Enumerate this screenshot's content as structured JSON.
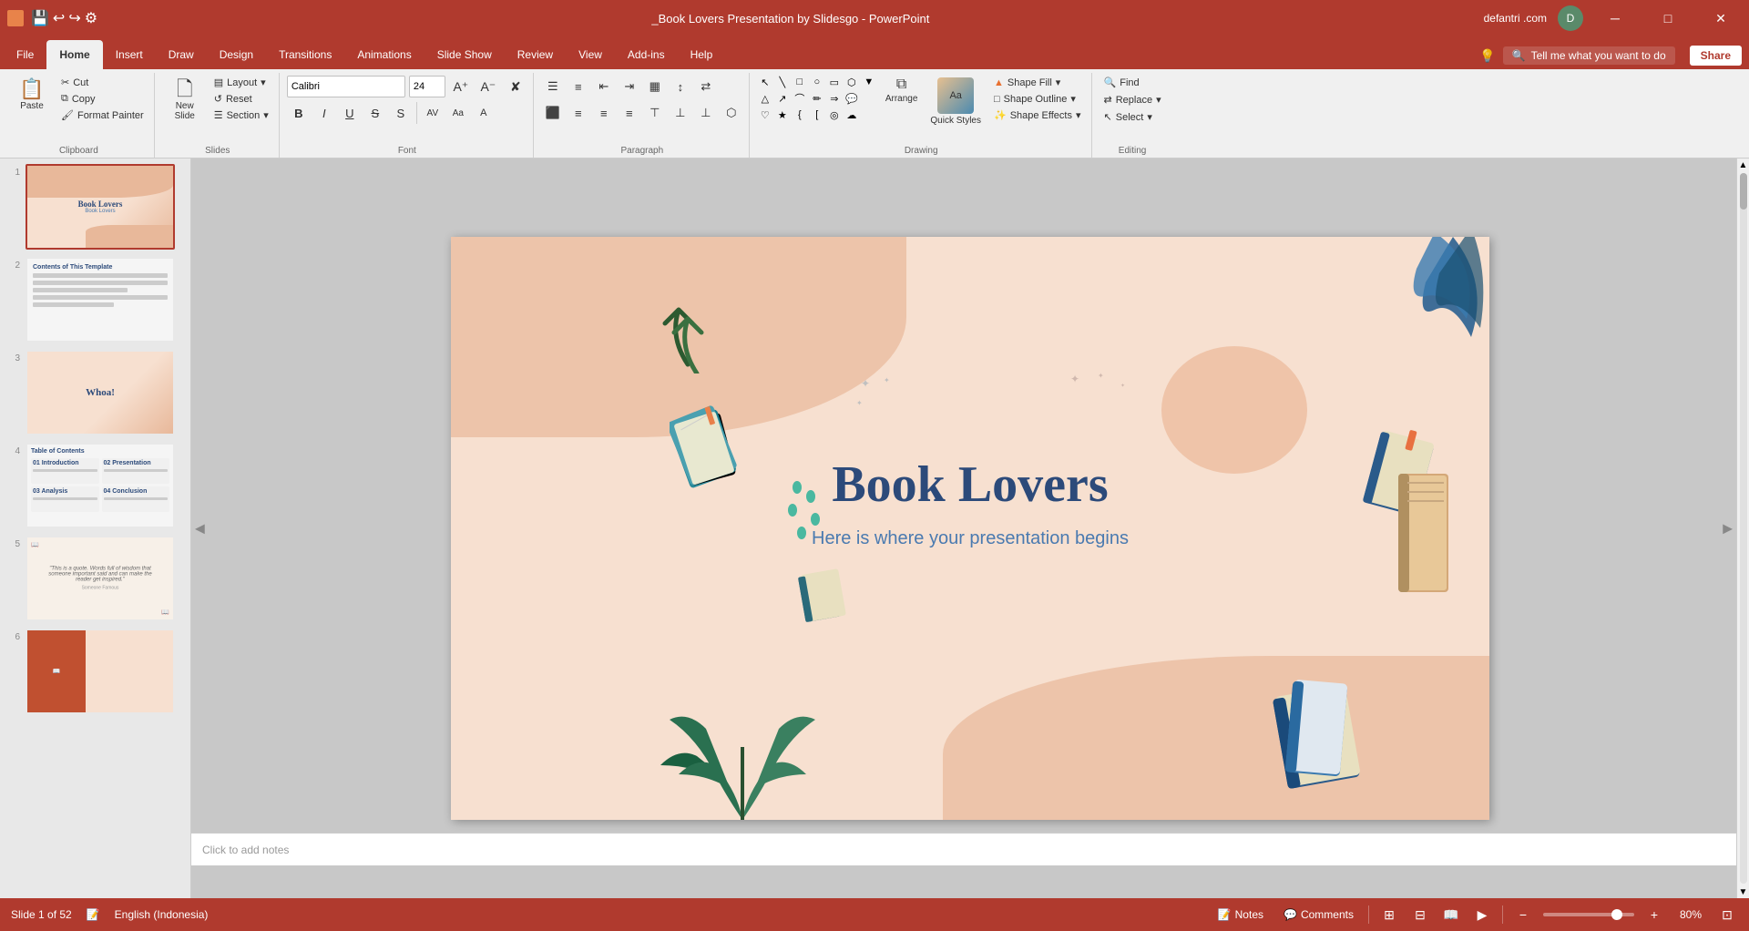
{
  "titlebar": {
    "title": "_Book Lovers Presentation by Slidesgo - PowerPoint",
    "user": "defantri .com",
    "save_icon": "💾",
    "undo_icon": "↩",
    "redo_icon": "↪",
    "settings_icon": "⚙"
  },
  "tabs": {
    "file": "File",
    "home": "Home",
    "insert": "Insert",
    "draw": "Draw",
    "design": "Design",
    "transitions": "Transitions",
    "animations": "Animations",
    "slideshow": "Slide Show",
    "review": "Review",
    "view": "View",
    "addins": "Add-ins",
    "help": "Help",
    "search": "Tell me what you want to do",
    "share": "Share"
  },
  "ribbon": {
    "clipboard_label": "Clipboard",
    "slides_label": "Slides",
    "font_label": "Font",
    "paragraph_label": "Paragraph",
    "drawing_label": "Drawing",
    "editing_label": "Editing",
    "paste_label": "Paste",
    "new_slide_label": "New\nSlide",
    "layout_label": "Layout",
    "reset_label": "Reset",
    "section_label": "Section",
    "font_name": "Calibri",
    "font_size": "24",
    "bold": "B",
    "italic": "I",
    "underline": "U",
    "strikethrough": "S",
    "arrange_label": "Arrange",
    "quick_styles_label": "Quick\nStyles",
    "shape_fill_label": "Shape Fill",
    "shape_outline_label": "Shape Outline",
    "shape_effects_label": "Shape Effects",
    "find_label": "Find",
    "replace_label": "Replace",
    "select_label": "Select"
  },
  "slide_panel": {
    "slides": [
      {
        "num": "1",
        "active": true
      },
      {
        "num": "2",
        "active": false
      },
      {
        "num": "3",
        "active": false
      },
      {
        "num": "4",
        "active": false
      },
      {
        "num": "5",
        "active": false
      },
      {
        "num": "6",
        "active": false
      }
    ]
  },
  "slide": {
    "title": "Book Lovers",
    "subtitle": "Here is where your presentation begins"
  },
  "notes_placeholder": "Click to add notes",
  "statusbar": {
    "slide_info": "Slide 1 of 52",
    "language": "English (Indonesia)",
    "notes_label": "Notes",
    "comments_label": "Comments",
    "zoom": "80%"
  }
}
